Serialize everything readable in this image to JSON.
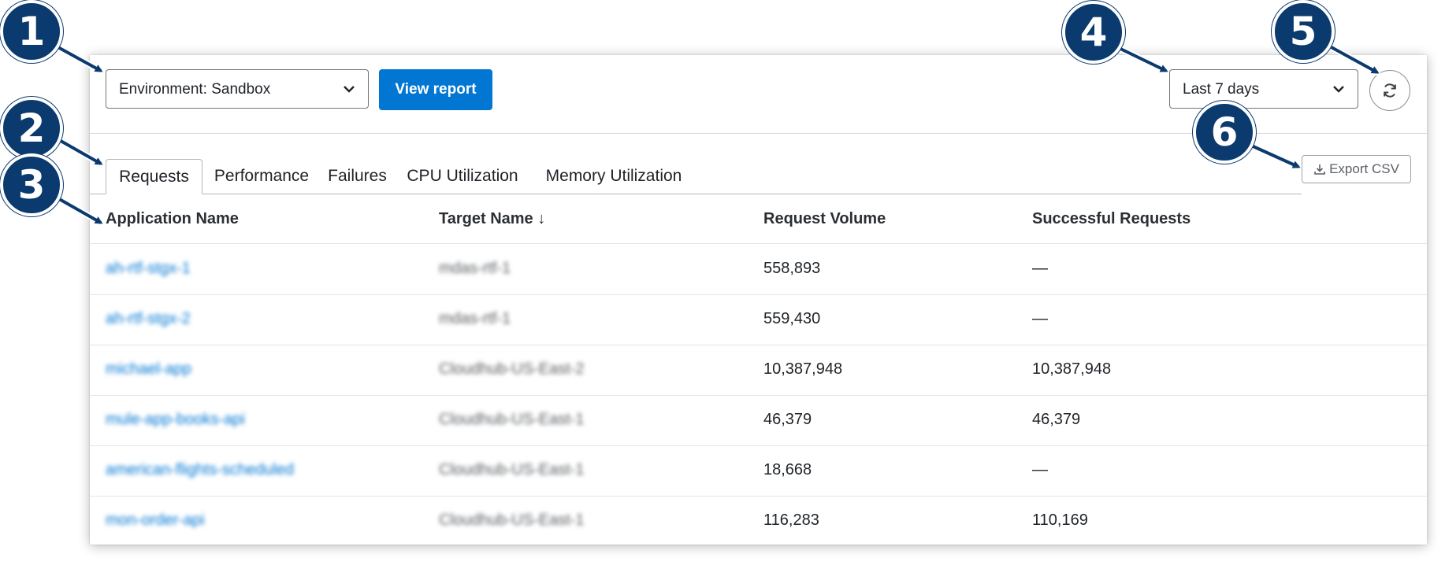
{
  "toolbar": {
    "environment_label": "Environment: Sandbox",
    "view_report_label": "View report",
    "time_range_label": "Last 7 days",
    "refresh_icon": "refresh-icon",
    "export_label": "Export CSV",
    "export_icon": "download-icon"
  },
  "tabs": [
    {
      "label": "Requests",
      "active": true
    },
    {
      "label": "Performance",
      "active": false
    },
    {
      "label": "Failures",
      "active": false
    },
    {
      "label": "CPU Utilization",
      "active": false
    },
    {
      "label": "Memory Utilization",
      "active": false
    }
  ],
  "table": {
    "columns": [
      "Application Name",
      "Target Name",
      "Request Volume",
      "Successful Requests"
    ],
    "sort_indicator": "↓",
    "rows": [
      {
        "app": "ah-rtf-stgx-1",
        "target": "mdas-rtf-1",
        "volume": "558,893",
        "success": "—"
      },
      {
        "app": "ah-rtf-stgx-2",
        "target": "mdas-rtf-1",
        "volume": "559,430",
        "success": "—"
      },
      {
        "app": "michael-app",
        "target": "Cloudhub-US-East-2",
        "volume": "10,387,948",
        "success": "10,387,948"
      },
      {
        "app": "mule-app-books-api",
        "target": "Cloudhub-US-East-1",
        "volume": "46,379",
        "success": "46,379"
      },
      {
        "app": "american-flights-scheduled",
        "target": "Cloudhub-US-East-1",
        "volume": "18,668",
        "success": "—"
      },
      {
        "app": "mon-order-api",
        "target": "Cloudhub-US-East-1",
        "volume": "116,283",
        "success": "110,169"
      }
    ]
  },
  "callouts": [
    "1",
    "2",
    "3",
    "4",
    "5",
    "6"
  ],
  "colors": {
    "accent": "#0176d3",
    "callout": "#0b3a6e"
  }
}
